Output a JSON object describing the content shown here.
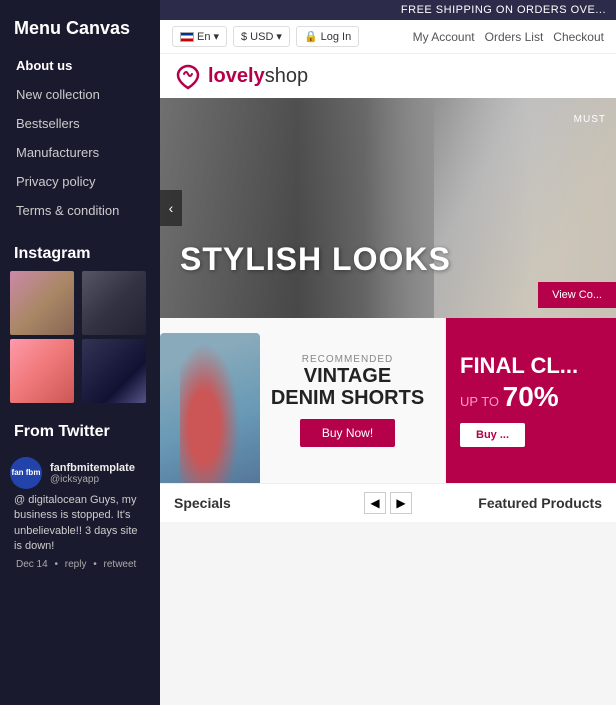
{
  "sidebar": {
    "title": "Menu Canvas",
    "nav_items": [
      {
        "label": "About us",
        "active": true
      },
      {
        "label": "New collection",
        "active": false
      },
      {
        "label": "Bestsellers",
        "active": false
      },
      {
        "label": "Manufacturers",
        "active": false
      },
      {
        "label": "Privacy policy",
        "active": false
      },
      {
        "label": "Terms & condition",
        "active": false
      }
    ],
    "instagram_title": "Instagram",
    "twitter_title": "From Twitter",
    "twitter": {
      "avatar_text": "fan fbm",
      "name": "fanfbmitemplate",
      "handle": "@icksyapp",
      "tweet": "@ digitalocean Guys, my business is stopped. It's unbelievable!! 3 days site is down!",
      "date": "Dec 14",
      "reply": "reply",
      "retweet": "retweet"
    }
  },
  "topbanner": {
    "text": "FREE SHIPPING ON ORDERS OVE..."
  },
  "header": {
    "lang": "En",
    "currency": "$ USD",
    "login": "Log In",
    "my_account": "My Account",
    "orders_list": "Orders List",
    "checkout": "Checkout"
  },
  "logo": {
    "brand": "lovely",
    "brand2": "shop"
  },
  "hero": {
    "label": "MUST",
    "heading": "STYLISH LOOKS",
    "view_btn": "View Co..."
  },
  "product_left": {
    "recommended": "RECOMMENDED",
    "title_line1": "VINTAGE",
    "title_line2": "DENIM SHORTS",
    "buy_btn": "Buy Now!"
  },
  "product_right": {
    "title": "FINAL CL...",
    "sub": "UP TO",
    "pct": "70%",
    "buy_btn": "Buy ..."
  },
  "bottom": {
    "specials": "Specials",
    "featured": "Featured Products",
    "prev_label": "◀",
    "next_label": "▶"
  }
}
